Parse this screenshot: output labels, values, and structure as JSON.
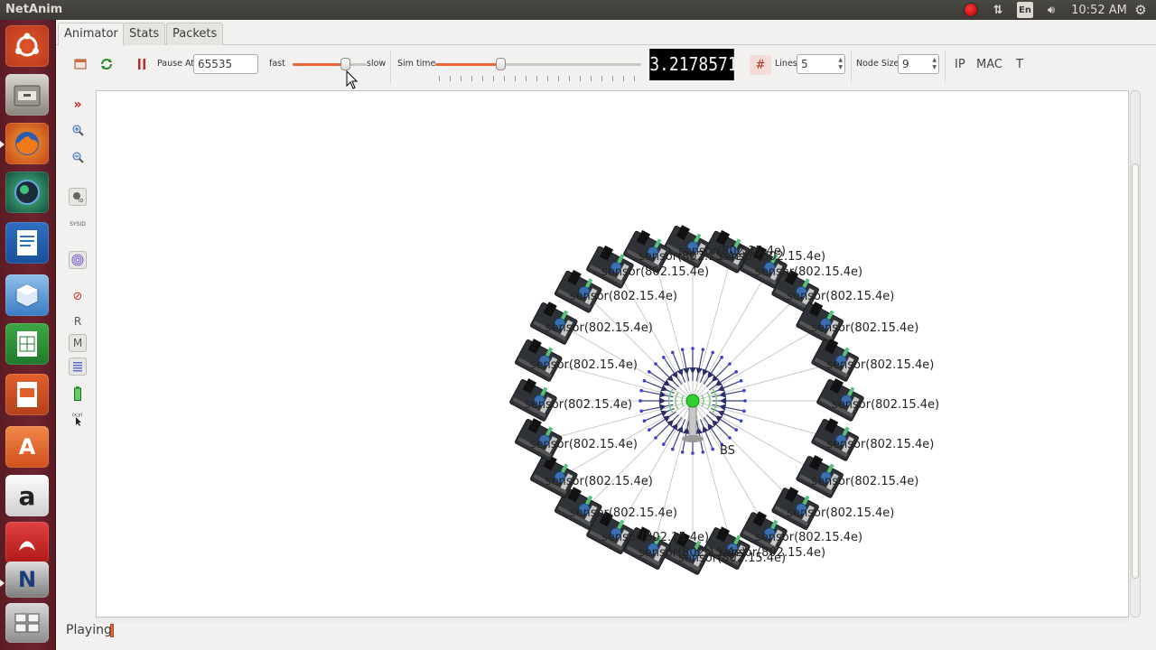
{
  "app_title": "NetAnim",
  "top_panel": {
    "language": "En",
    "clock": "10:52 AM"
  },
  "tabs": [
    "Animator",
    "Stats",
    "Packets"
  ],
  "toolbar": {
    "pause_at_label": "Pause At",
    "pause_at_value": "65535",
    "fast_label": "fast",
    "slow_label": "slow",
    "speed_fraction": 0.75,
    "sim_time_label": "Sim time",
    "sim_time_fraction": 0.31,
    "sim_time_display": "3.2178571",
    "lines_label": "Lines",
    "lines_value": "5",
    "node_size_label": "Node Size",
    "node_size_value": "9",
    "ip_label": "IP",
    "mac_label": "MAC",
    "t_label": "T"
  },
  "side_tools": {
    "r_label": "R",
    "m_label": "M",
    "sysid_label": "SYSID"
  },
  "network": {
    "sensor_label": "sensor(802.15.4e)",
    "sensor_count": 24,
    "base_station_label": "BS"
  },
  "status": {
    "text": "Playing"
  },
  "colors": {
    "accent": "#e8663a",
    "launcher": "#6e2430",
    "panel": "#3b3a36"
  }
}
